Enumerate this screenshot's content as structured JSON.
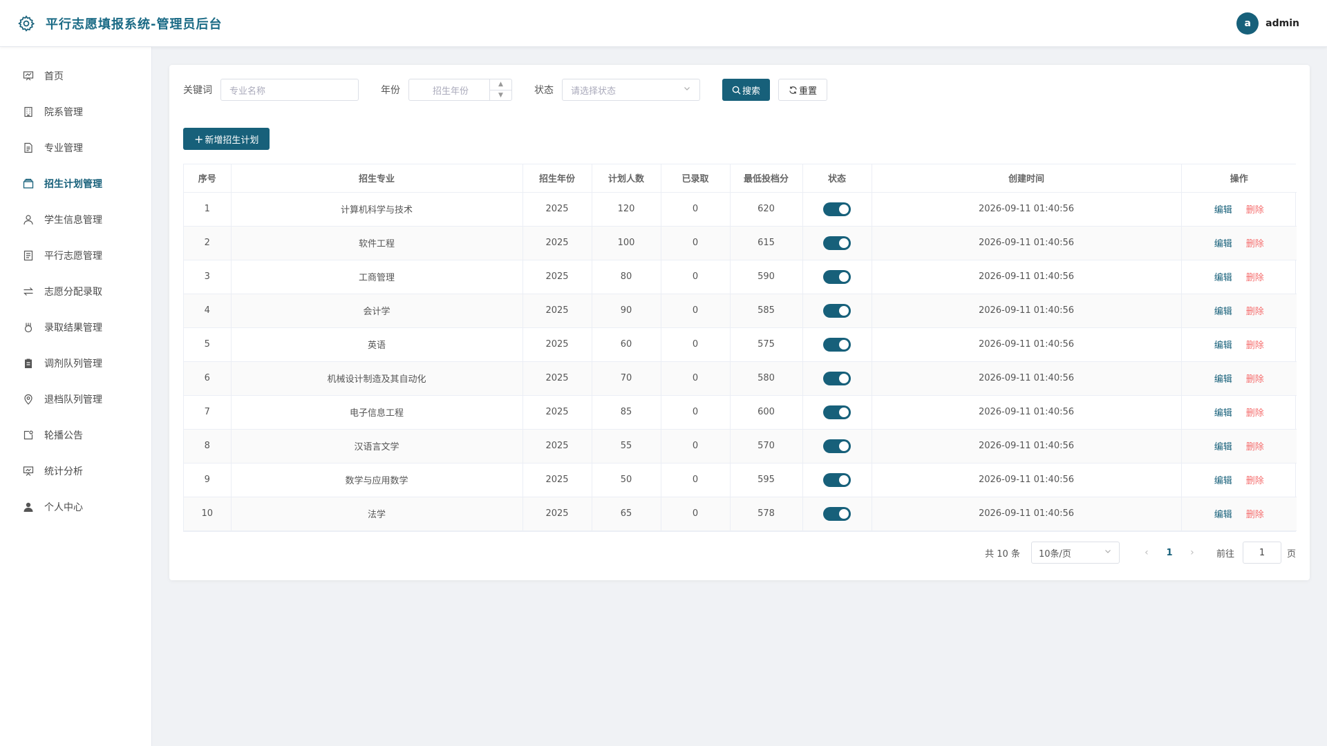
{
  "header": {
    "title": "平行志愿填报系统-管理员后台",
    "avatar_letter": "a",
    "username": "admin"
  },
  "sidebar": {
    "items": [
      {
        "label": "首页",
        "icon": "chart-icon"
      },
      {
        "label": "院系管理",
        "icon": "building-icon"
      },
      {
        "label": "专业管理",
        "icon": "document-icon"
      },
      {
        "label": "招生计划管理",
        "icon": "folder-icon",
        "active": true
      },
      {
        "label": "学生信息管理",
        "icon": "user-icon"
      },
      {
        "label": "平行志愿管理",
        "icon": "list-doc-icon"
      },
      {
        "label": "志愿分配录取",
        "icon": "switch-arrows-icon"
      },
      {
        "label": "录取结果管理",
        "icon": "medal-icon"
      },
      {
        "label": "调剂队列管理",
        "icon": "clipboard-icon"
      },
      {
        "label": "退档队列管理",
        "icon": "location-icon"
      },
      {
        "label": "轮播公告",
        "icon": "picture-icon"
      },
      {
        "label": "统计分析",
        "icon": "presentation-icon"
      },
      {
        "label": "个人中心",
        "icon": "user-filled-icon"
      }
    ]
  },
  "filters": {
    "keyword_label": "关键词",
    "keyword_placeholder": "专业名称",
    "year_label": "年份",
    "year_placeholder": "招生年份",
    "status_label": "状态",
    "status_placeholder": "请选择状态",
    "search_label": "搜索",
    "reset_label": "重置"
  },
  "add_button_label": "新增招生计划",
  "table": {
    "columns": [
      "序号",
      "招生专业",
      "招生年份",
      "计划人数",
      "已录取",
      "最低投档分",
      "状态",
      "创建时间",
      "操作"
    ],
    "edit_label": "编辑",
    "delete_label": "删除",
    "rows": [
      {
        "no": "1",
        "major": "计算机科学与技术",
        "year": "2025",
        "plan": "120",
        "admitted": "0",
        "min_score": "620",
        "enabled": true,
        "created": "2026-09-11 01:40:56"
      },
      {
        "no": "2",
        "major": "软件工程",
        "year": "2025",
        "plan": "100",
        "admitted": "0",
        "min_score": "615",
        "enabled": true,
        "created": "2026-09-11 01:40:56"
      },
      {
        "no": "3",
        "major": "工商管理",
        "year": "2025",
        "plan": "80",
        "admitted": "0",
        "min_score": "590",
        "enabled": true,
        "created": "2026-09-11 01:40:56"
      },
      {
        "no": "4",
        "major": "会计学",
        "year": "2025",
        "plan": "90",
        "admitted": "0",
        "min_score": "585",
        "enabled": true,
        "created": "2026-09-11 01:40:56"
      },
      {
        "no": "5",
        "major": "英语",
        "year": "2025",
        "plan": "60",
        "admitted": "0",
        "min_score": "575",
        "enabled": true,
        "created": "2026-09-11 01:40:56"
      },
      {
        "no": "6",
        "major": "机械设计制造及其自动化",
        "year": "2025",
        "plan": "70",
        "admitted": "0",
        "min_score": "580",
        "enabled": true,
        "created": "2026-09-11 01:40:56"
      },
      {
        "no": "7",
        "major": "电子信息工程",
        "year": "2025",
        "plan": "85",
        "admitted": "0",
        "min_score": "600",
        "enabled": true,
        "created": "2026-09-11 01:40:56"
      },
      {
        "no": "8",
        "major": "汉语言文学",
        "year": "2025",
        "plan": "55",
        "admitted": "0",
        "min_score": "570",
        "enabled": true,
        "created": "2026-09-11 01:40:56"
      },
      {
        "no": "9",
        "major": "数学与应用数学",
        "year": "2025",
        "plan": "50",
        "admitted": "0",
        "min_score": "595",
        "enabled": true,
        "created": "2026-09-11 01:40:56"
      },
      {
        "no": "10",
        "major": "法学",
        "year": "2025",
        "plan": "65",
        "admitted": "0",
        "min_score": "578",
        "enabled": true,
        "created": "2026-09-11 01:40:56"
      }
    ]
  },
  "pagination": {
    "total_text": "共 10 条",
    "page_size": "10条/页",
    "current_page": "1",
    "goto_label": "前往",
    "goto_value": "1",
    "page_suffix": "页"
  },
  "colors": {
    "primary": "#17607a",
    "danger": "#f56c6c"
  }
}
